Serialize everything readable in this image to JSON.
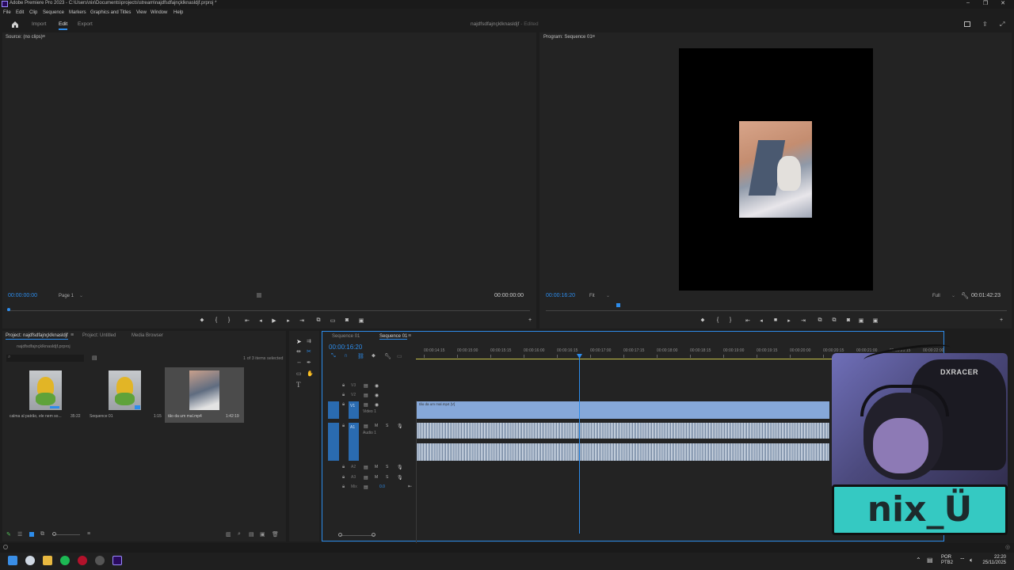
{
  "window": {
    "title": "Adobe Premiere Pro 2023 - C:\\Users\\nix\\Documents\\projects\\stream\\najdfsdfajnçklknasldjf.prproj *"
  },
  "menu": [
    "File",
    "Edit",
    "Clip",
    "Sequence",
    "Markers",
    "Graphics and Titles",
    "View",
    "Window",
    "Help"
  ],
  "workspace": {
    "tabs": [
      "Import",
      "Edit",
      "Export"
    ],
    "active": "Edit",
    "project_name": "najdfsdfajnçklknasldjf",
    "edited_label": "- Edited"
  },
  "source": {
    "title": "Source: (no clips)",
    "timecode_left": "00:00:00:00",
    "page_label": "Page 1",
    "timecode_right": "00:00:00:00"
  },
  "program": {
    "title": "Program: Sequence 01",
    "timecode": "00:00:16:20",
    "fit": "Fit",
    "quality": "Full",
    "duration": "00:01:42:23"
  },
  "project": {
    "tabs": [
      "Project: najdfsdfajnçklknasldjf",
      "Project: Untitled",
      "Media Browser"
    ],
    "bin_path": "najdfsdfajnçklknasldjf.prproj",
    "selection": "1 of 3 items selected",
    "items": [
      {
        "name": "calma al patrão, ele nem so...",
        "duration": "35:22"
      },
      {
        "name": "Sequence 01",
        "duration": "1:15"
      },
      {
        "name": "tão da um mal.mp4",
        "duration": "1:42:19"
      }
    ]
  },
  "timeline": {
    "tabs": [
      "Sequence 01",
      "Sequence 01"
    ],
    "timecode": "00:00:16:20",
    "ruler": [
      "00:00:14:15",
      "00:00:15:00",
      "00:00:15:15",
      "00:00:16:00",
      "00:00:16:15",
      "00:00:17:00",
      "00:00:17:15",
      "00:00:18:00",
      "00:00:18:15",
      "00:00:19:00",
      "00:00:19:15",
      "00:00:20:00",
      "00:00:20:15",
      "00:00:21:00",
      "00:00:21:15",
      "00:00:22:00"
    ],
    "tracks": [
      {
        "id": "V3",
        "label": ""
      },
      {
        "id": "V2",
        "label": ""
      },
      {
        "id": "V1",
        "label": "Video 1"
      },
      {
        "id": "A1",
        "label": "Audio 1"
      },
      {
        "id": "A2",
        "label": ""
      },
      {
        "id": "A3",
        "label": ""
      },
      {
        "id": "Mix",
        "label": "Mix"
      }
    ],
    "mix_value": "0.0",
    "clip_label": "tão da um mal.mp4 [V]"
  },
  "overlay": {
    "tag": "nix_Ü",
    "chair_brand": "DXRACER"
  },
  "taskbar": {
    "lang": "POR",
    "layout": "PTB2",
    "time": "22:20",
    "date": "25/11/2025"
  },
  "colors": {
    "accent": "#2d8ceb",
    "clip_video": "#86a8d9",
    "overlay_teal": "#35c9c2"
  }
}
